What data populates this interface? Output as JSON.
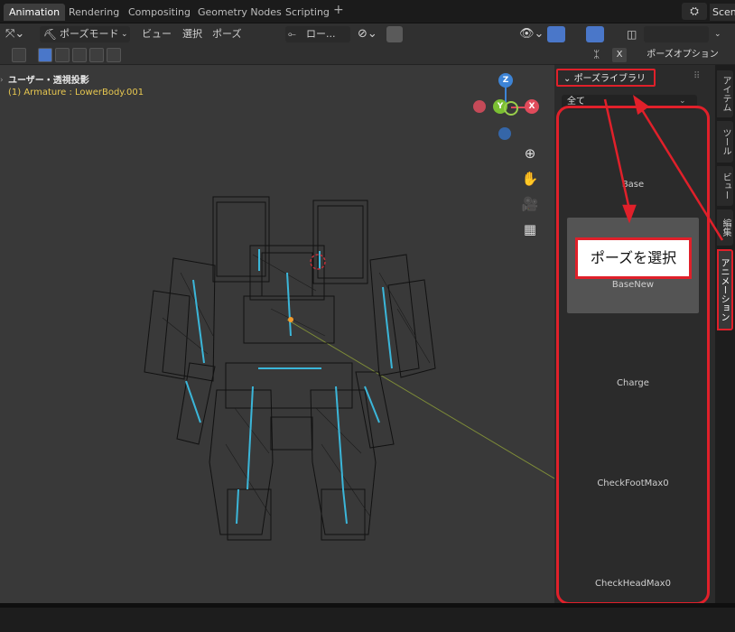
{
  "workspace_tabs": [
    {
      "label": "Animation",
      "active": true
    },
    {
      "label": "Rendering",
      "active": false
    },
    {
      "label": "Compositing",
      "active": false
    },
    {
      "label": "Geometry Nodes",
      "active": false
    },
    {
      "label": "Scripting",
      "active": false
    }
  ],
  "add_tab_symbol": "+",
  "scene_label": "Scen",
  "header": {
    "mode": "ポーズモード",
    "menus": [
      "ビュー",
      "選択",
      "ポーズ"
    ],
    "pivot": "ロー..."
  },
  "toolrow": {
    "close_x": "X",
    "pose_options": "ポーズオプション"
  },
  "viewport": {
    "title": "ユーザー・透視投影",
    "subtitle": "(1) Armature : LowerBody.001",
    "gizmo_axes": {
      "x": "X",
      "y": "Y",
      "z": "Z"
    }
  },
  "pose_library": {
    "header": "ポーズライブラリ",
    "filter": "全て",
    "items": [
      {
        "name": "Base",
        "selected": false
      },
      {
        "name": "BaseNew",
        "selected": true
      },
      {
        "name": "Charge",
        "selected": false
      },
      {
        "name": "CheckFootMax0",
        "selected": false
      },
      {
        "name": "CheckHeadMax0",
        "selected": false
      }
    ]
  },
  "side_tabs": [
    "アイテム",
    "ツール",
    "ビュー",
    "編集",
    "アニメーション"
  ],
  "active_side_tab": "アニメーション",
  "callout_text": "ポーズを選択",
  "colors": {
    "annotation_red": "#e0202a",
    "x_axis": "#e04b5b",
    "y_axis": "#7bbf33",
    "z_axis": "#3d84d6",
    "selected_text": "#e8c850"
  }
}
